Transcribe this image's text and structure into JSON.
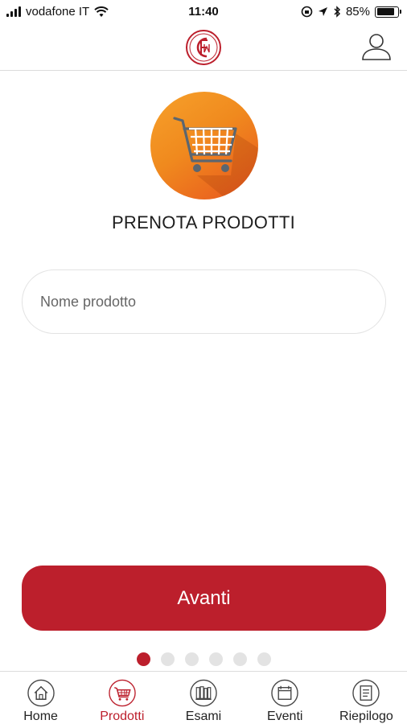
{
  "status_bar": {
    "carrier": "vodafone IT",
    "time": "11:40",
    "battery_percent": "85%",
    "battery_level": 0.85
  },
  "header": {
    "logo_icon": "cfm-logo-icon",
    "profile_icon": "user-profile-icon"
  },
  "main": {
    "hero_icon": "shopping-cart-icon",
    "title": "PRENOTA PRODOTTI",
    "search_placeholder": "Nome prodotto",
    "search_value": "",
    "next_button_label": "Avanti"
  },
  "pager": {
    "total": 6,
    "active_index": 0
  },
  "tabs": [
    {
      "label": "Home",
      "icon": "home-icon",
      "active": false
    },
    {
      "label": "Prodotti",
      "icon": "cart-icon",
      "active": true
    },
    {
      "label": "Esami",
      "icon": "books-icon",
      "active": false
    },
    {
      "label": "Eventi",
      "icon": "calendar-icon",
      "active": false
    },
    {
      "label": "Riepilogo",
      "icon": "document-icon",
      "active": false
    }
  ],
  "colors": {
    "accent": "#bc1f2c",
    "hero_gradient_start": "#f7a12b",
    "hero_gradient_end": "#e8551f",
    "inactive_dot": "#e3e3e3"
  }
}
